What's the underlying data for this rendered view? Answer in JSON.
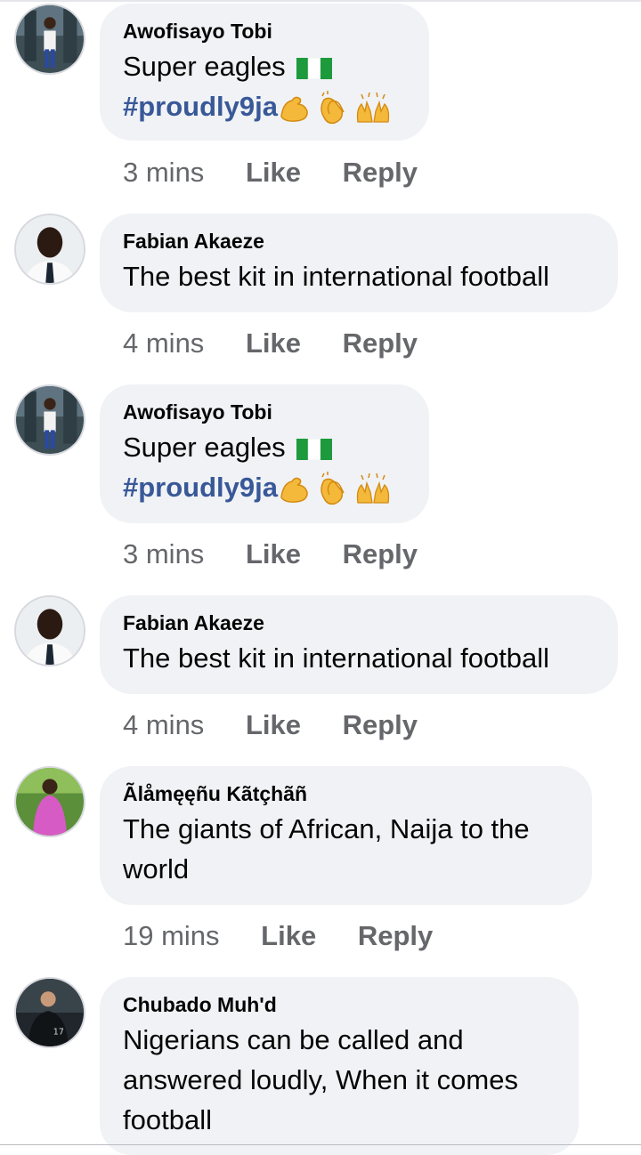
{
  "comments": [
    {
      "author": "Awofisayo Tobi",
      "text": "Super eagles",
      "flag_emoji": "nigeria-flag",
      "hashtag": "#proudly9ja",
      "emojis": [
        "flexed-biceps",
        "clapping-hands",
        "raising-hands"
      ],
      "time": "3 mins",
      "like": "Like",
      "reply": "Reply"
    },
    {
      "author": "Fabian Akaeze",
      "text": "The best kit in international football",
      "time": "4 mins",
      "like": "Like",
      "reply": "Reply"
    },
    {
      "author": "Awofisayo Tobi",
      "text": "Super eagles",
      "flag_emoji": "nigeria-flag",
      "hashtag": "#proudly9ja",
      "emojis": [
        "flexed-biceps",
        "clapping-hands",
        "raising-hands"
      ],
      "time": "3 mins",
      "like": "Like",
      "reply": "Reply"
    },
    {
      "author": "Fabian Akaeze",
      "text": "The best kit in international football",
      "time": "4 mins",
      "like": "Like",
      "reply": "Reply"
    },
    {
      "author": "Ãlåmęęñu Kãtçhãñ",
      "text": "The giants of African, Naija to the world",
      "time": "19 mins",
      "like": "Like",
      "reply": "Reply"
    },
    {
      "author": "Chubado Muh'd",
      "text": "Nigerians can be called and answered loudly, When it comes football"
    }
  ],
  "colors": {
    "bubble": "#f0f2f5",
    "hashtag": "#385898",
    "meta": "#65676b"
  }
}
